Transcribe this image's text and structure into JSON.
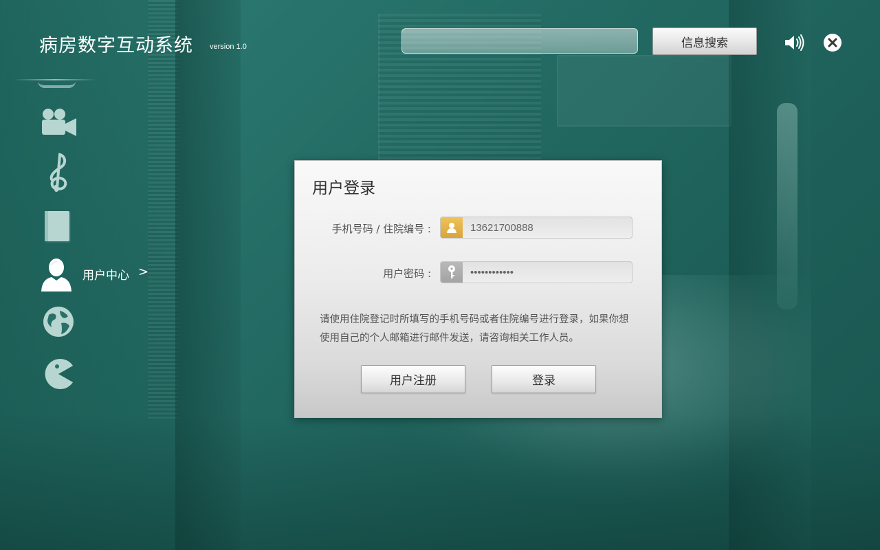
{
  "app": {
    "title": "病房数字互动系统",
    "version": "version 1.0"
  },
  "header": {
    "search_value": "",
    "search_button_label": "信息搜索",
    "volume_icon": "volume-icon",
    "close_icon": "close-icon"
  },
  "sidebar": {
    "items": [
      {
        "icon": "video-camera-icon"
      },
      {
        "icon": "music-note-icon"
      },
      {
        "icon": "book-icon"
      },
      {
        "icon": "user-icon",
        "label": "用户中心",
        "arrow": ">",
        "active": true
      },
      {
        "icon": "globe-icon"
      },
      {
        "icon": "pacman-icon"
      }
    ]
  },
  "login": {
    "title": "用户登录",
    "phone_label": "手机号码 / 住院编号 :",
    "phone_value": "13621700888",
    "password_label": "用户密码 :",
    "password_value": "••••••••••••",
    "note": "请使用住院登记时所填写的手机号码或者住院编号进行登录，如果你想使用自己的个人邮箱进行邮件发送，请咨询相关工作人员。",
    "register_label": "用户注册",
    "login_label": "登录"
  },
  "colors": {
    "background": "#236b64",
    "user_icon_accent": "#e4b048",
    "key_icon_accent": "#adadad"
  }
}
